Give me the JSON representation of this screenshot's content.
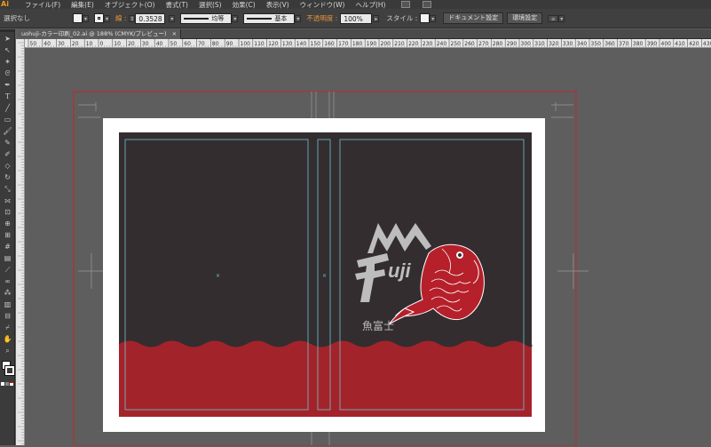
{
  "app": {
    "logo": "Ai"
  },
  "menu": {
    "items": [
      "ファイル(F)",
      "編集(E)",
      "オブジェクト(O)",
      "書式(T)",
      "選択(S)",
      "効果(C)",
      "表示(V)",
      "ウィンドウ(W)",
      "ヘルプ(H)"
    ]
  },
  "control_bar": {
    "selection_status": "選択なし",
    "stroke_label": "線 :",
    "stroke_weight": "0.3528",
    "profile_label": "均等",
    "brush_label": "基本",
    "opacity_label": "不透明度 :",
    "opacity_value": "100%",
    "style_label": "スタイル :",
    "doc_settings_button": "ドキュメント設定",
    "preferences_button": "環境設定"
  },
  "document_tab": {
    "title": "uohuji-カラー印刷_02.ai @ 188% (CMYK/プレビュー)",
    "close": "×"
  },
  "rulers": {
    "horizontal_ticks": [
      "50",
      "40",
      "30",
      "20",
      "10",
      "0",
      "10",
      "20",
      "30",
      "40",
      "50",
      "60",
      "70",
      "80",
      "90",
      "100",
      "110",
      "120",
      "130",
      "140",
      "150",
      "160",
      "170",
      "180",
      "190",
      "200",
      "210",
      "220",
      "230",
      "240",
      "250",
      "260",
      "270",
      "280",
      "290",
      "300",
      "310",
      "320",
      "330",
      "340",
      "350",
      "360",
      "370",
      "380",
      "390",
      "400",
      "410",
      "420",
      "430"
    ]
  },
  "artwork": {
    "logo_wordmark": "Fuji",
    "kanji_name": "魚富士",
    "colors": {
      "dark": "#332d30",
      "red": "#a3232a",
      "fish_red": "#b5202a",
      "grey": "#bdbdbd",
      "guide": "#6fc4cf",
      "bleed": "#c0282d"
    }
  },
  "tools": [
    "selection-tool-icon",
    "direct-selection-tool-icon",
    "magic-wand-icon",
    "lasso-icon",
    "pen-tool-icon",
    "type-tool-icon",
    "line-tool-icon",
    "rectangle-tool-icon",
    "paintbrush-icon",
    "pencil-icon",
    "blob-brush-icon",
    "eraser-icon",
    "rotate-tool-icon",
    "scale-tool-icon",
    "width-tool-icon",
    "free-transform-icon",
    "shape-builder-icon",
    "perspective-grid-icon",
    "mesh-tool-icon",
    "gradient-tool-icon",
    "eyedropper-icon",
    "blend-tool-icon",
    "symbol-sprayer-icon",
    "graph-tool-icon",
    "artboard-tool-icon",
    "slice-tool-icon",
    "hand-tool-icon",
    "zoom-tool-icon"
  ]
}
